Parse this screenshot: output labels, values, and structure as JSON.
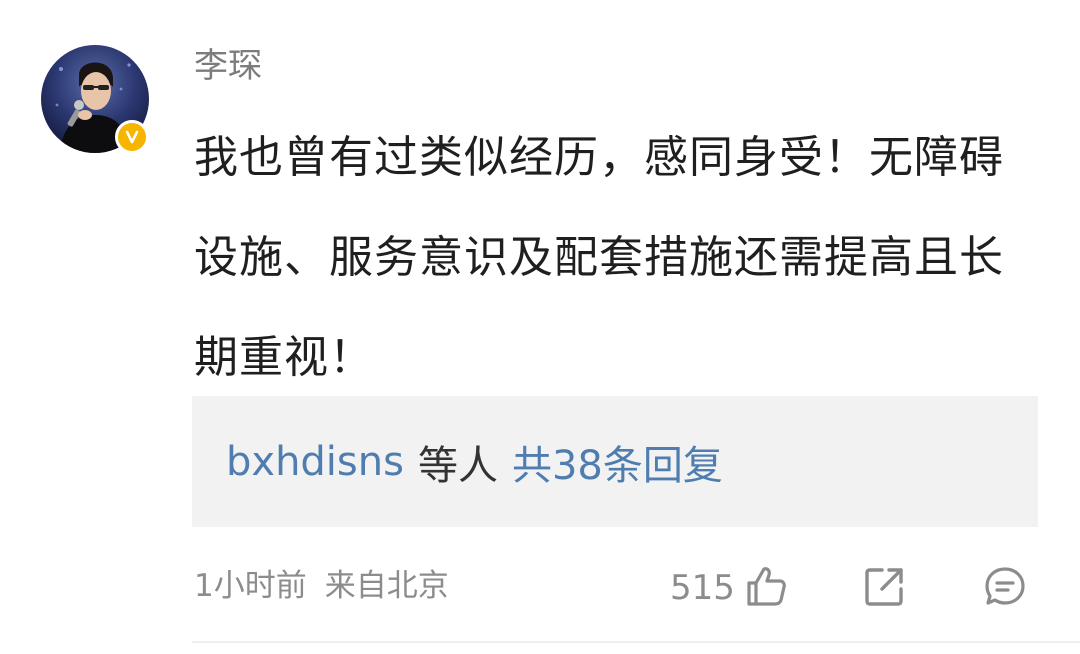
{
  "comment": {
    "author": "李琛",
    "verified": true,
    "text": "我也曾有过类似经历，感同身受！无障碍设施、服务意识及配套措施还需提高且长期重视！",
    "replies": {
      "users": "bxhdisns",
      "connector": "等人",
      "count_label": "共38条回复"
    },
    "time": "1小时前",
    "source": "来自北京",
    "likes": "515"
  },
  "icons": {
    "like": "thumbs-up-icon",
    "share": "share-icon",
    "comment": "comment-icon",
    "verified": "verified-v-icon"
  },
  "colors": {
    "link": "#507daf",
    "badge": "#f7b500",
    "reply_bg": "#f2f2f2"
  }
}
